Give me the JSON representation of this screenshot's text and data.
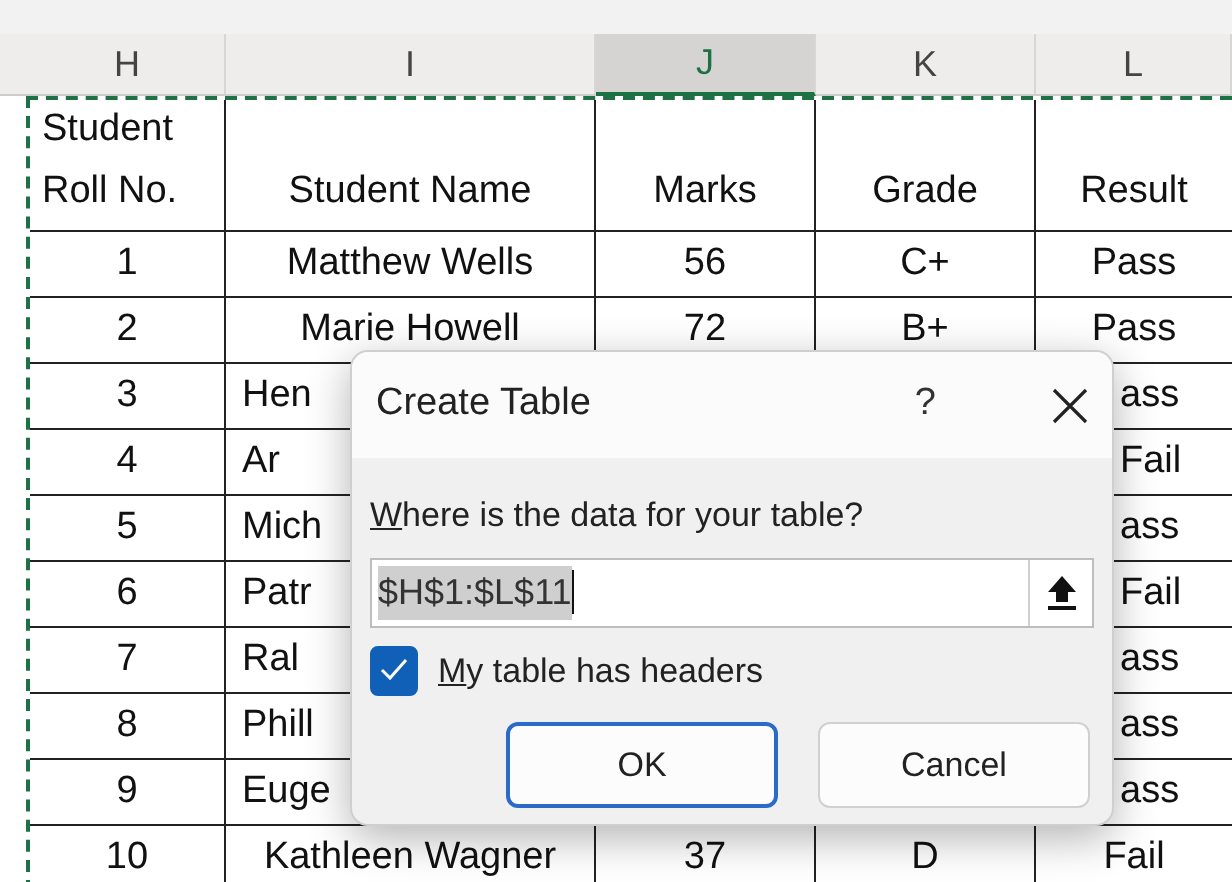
{
  "columns": [
    {
      "label": "H",
      "selected": false
    },
    {
      "label": "I",
      "selected": false
    },
    {
      "label": "J",
      "selected": true
    },
    {
      "label": "K",
      "selected": false
    },
    {
      "label": "L",
      "selected": false
    }
  ],
  "header_row": [
    "Student Roll No.",
    "Student Name",
    "Marks",
    "Grade",
    "Result"
  ],
  "rows": [
    [
      "1",
      "Matthew Wells",
      "56",
      "C+",
      "Pass"
    ],
    [
      "2",
      "Marie Howell",
      "72",
      "B+",
      "Pass"
    ],
    [
      "3",
      "Hen",
      null,
      null,
      "ass"
    ],
    [
      "4",
      "Ar",
      null,
      null,
      "Fail"
    ],
    [
      "5",
      "Mich",
      null,
      null,
      "ass"
    ],
    [
      "6",
      "Patr",
      null,
      null,
      "Fail"
    ],
    [
      "7",
      "Ral",
      null,
      null,
      "ass"
    ],
    [
      "8",
      "Phill",
      null,
      null,
      "ass"
    ],
    [
      "9",
      "Euge",
      null,
      null,
      "ass"
    ],
    [
      "10",
      "Kathleen Wagner",
      "37",
      "D",
      "Fail"
    ]
  ],
  "dialog": {
    "title": "Create Table",
    "help": "?",
    "range_label": {
      "text": "Where is the data for your table?"
    },
    "range_field": {
      "value": "$H$1:$L$11",
      "selected": true
    },
    "headers_checkbox": {
      "label": "My table has headers",
      "checked": true
    },
    "buttons": [
      {
        "label": "OK",
        "default": true
      },
      {
        "label": "Cancel",
        "default": false
      }
    ]
  }
}
